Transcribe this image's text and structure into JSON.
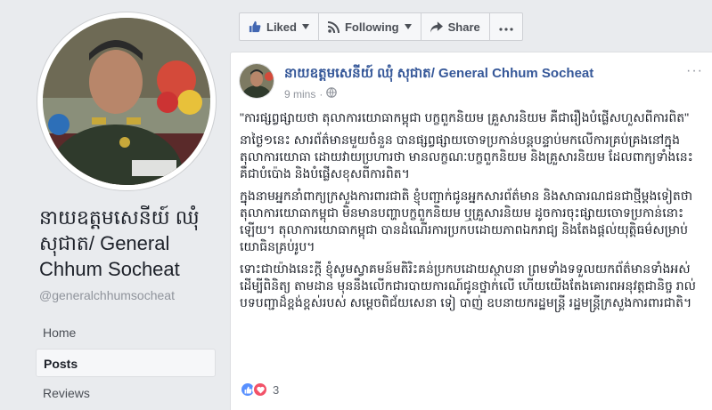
{
  "page": {
    "name": "នាយឧត្តមសេនីយ៍ ឈុំ សុជាត/ General Chhum Socheat",
    "handle": "@generalchhumsocheat"
  },
  "nav": {
    "items": [
      {
        "label": "Home"
      },
      {
        "label": "Posts"
      },
      {
        "label": "Reviews"
      }
    ]
  },
  "actions": {
    "liked": "Liked",
    "following": "Following",
    "share": "Share"
  },
  "post": {
    "author": "នាយឧត្តមសេនីយ៍ ឈុំ សុជាត/ General Chhum Socheat",
    "time": "9 mins",
    "paragraphs": [
      "\"ការផ្សព្វផ្សាយថា តុលាការយោធាកម្ពុជា បក្ខពួកនិយម គ្រួសារនិយម គឺជារឿងបំផ្លើសហួសពីការពិត\"",
      "នាថ្ងៃ១នេះ សារព័ត៌មានមួយចំនួន បានផ្សព្វផ្សាយចោទប្រកាន់បន្តបន្ទាប់មកលើការគ្រប់គ្រងនៅក្នុងតុលាការយោធា ដោយវាយប្រហារថា មានលក្ខណៈបក្ខពួកនិយម និងគ្រួសារនិយម ដែលពាក្យទាំងនេះគឺជាបំប៉ោង និងបំផ្លើសខុសពីការពិត។",
      "ក្នុងនាមអ្នកនាំពាក្យក្រសួងការពារជាតិ ខ្ញុំបញ្ជាក់ជូនអ្នកសារព័ត៌មាន និងសាធារណជនជាថ្មីម្តងទៀតថា តុលាការយោធាកម្ពុជា មិនមានបញ្ហាបក្ខពួកនិយម ឬគ្រួសារនិយម ដូចការចុះផ្សាយចោទប្រកាន់នោះឡើយ។ តុលាការយោធាកម្ពុជា បានដំណើរការប្រកបដោយភាពឯករាជ្យ និងតែងផ្តល់យុត្តិធម៌សម្រាប់យោធិនគ្រប់រូប។",
      "ទោះជាយ៉ាងនេះក្តី ខ្ញុំសូមស្វាគមន៍មតិរិះគន់ប្រកបដោយស្ថាបនា ព្រមទាំងទទួលយកព័ត៌មានទាំងអស់ ដើម្បីពិនិត្យ តាមដាន មុននឹងលើកជារបាយការណ៍ជូនថ្នាក់លើ ហើយយើងតែងគោរពអនុវត្តជានិច្ច រាល់បទបញ្ជាដ៏ខ្ពង់ខ្ពស់របស់ សម្តេចពិជ័យសេនា ទៀ បាញ់ ឧបនាយករដ្ឋមន្ត្រី រដ្ឋមន្ត្រីក្រសួងការពារជាតិ។"
    ],
    "reaction_count": "3"
  },
  "colors": {
    "link": "#365899",
    "like": "#5890ff",
    "love": "#f25268",
    "background": "#e9ebee"
  },
  "icons": {
    "liked": "thumbs-up-icon",
    "following": "rss-icon",
    "share": "share-arrow-icon",
    "more": "ellipsis-icon",
    "audience": "globe-icon"
  }
}
